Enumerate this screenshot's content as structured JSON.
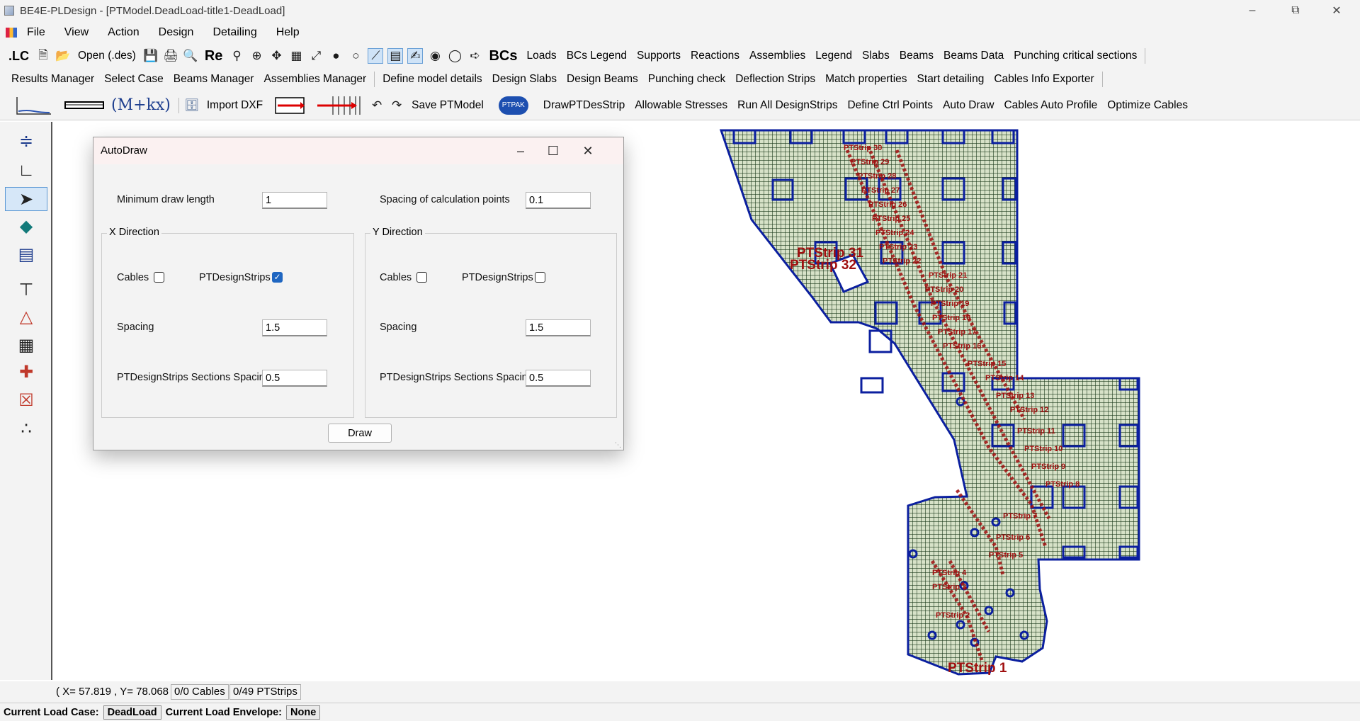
{
  "window": {
    "title": "BE4E-PLDesign - [PTModel.DeadLoad-title1-DeadLoad]"
  },
  "menu": [
    "File",
    "View",
    "Action",
    "Design",
    "Detailing",
    "Help"
  ],
  "toolbar1": {
    "lc": ".LC",
    "open": "Open (.des)",
    "re": "Re",
    "bcs": "BCs",
    "items": [
      "Loads",
      "BCs Legend",
      "Supports",
      "Reactions",
      "Assemblies",
      "Legend",
      "Slabs",
      "Beams",
      "Beams Data",
      "Punching critical sections"
    ]
  },
  "toolbar2": {
    "items": [
      "Results Manager",
      "Select Case",
      "Beams Manager",
      "Assemblies Manager",
      "Define model details",
      "Design Slabs",
      "Design Beams",
      "Punching check",
      "Deflection Strips",
      "Match properties",
      "Start detailing",
      "Cables Info Exporter"
    ]
  },
  "toolbar3": {
    "formula": "(M+kx)",
    "import_dxf": "Import DXF",
    "save": "Save PTModel",
    "ptpak": "PTPAK",
    "items": [
      "DrawPTDesStrip",
      "Allowable Stresses",
      "Run All DesignStrips",
      "Define Ctrl Points",
      "Auto Draw",
      "Cables Auto Profile",
      "Optimize Cables"
    ]
  },
  "dialog": {
    "title": "AutoDraw",
    "min_draw_length_label": "Minimum draw length",
    "min_draw_length": "1",
    "spacing_calc_label": "Spacing of calculation points",
    "spacing_calc": "0.1",
    "x": {
      "title": "X Direction",
      "cables_label": "Cables",
      "cables": false,
      "strips_label": "PTDesignStrips",
      "strips": true,
      "spacing_label": "Spacing",
      "spacing": "1.5",
      "section_label": "PTDesignStrips Sections Spacing",
      "section": "0.5"
    },
    "y": {
      "title": "Y Direction",
      "cables_label": "Cables",
      "cables": false,
      "strips_label": "PTDesignStrips",
      "strips": false,
      "spacing_label": "Spacing",
      "spacing": "1.5",
      "section_label": "PTDesignStrips Sections Spacing",
      "section": "0.5"
    },
    "draw_button": "Draw"
  },
  "canvas": {
    "labels": [
      "PTStrip 31",
      "PTStrip 32",
      "PTStrip 1"
    ],
    "colors": {
      "slab": "#0b1f9f",
      "mesh": "#1c3a1c",
      "strip": "#a01010",
      "fill": "#d7e2c8"
    }
  },
  "status": {
    "coords": "( X= 57.819 , Y= 78.068 )",
    "cables": "0/0 Cables",
    "strips": "0/49 PTStrips",
    "load_case_label": "Current Load Case:",
    "load_case": "DeadLoad",
    "envelope_label": "Current Load Envelope:",
    "envelope": "None"
  }
}
